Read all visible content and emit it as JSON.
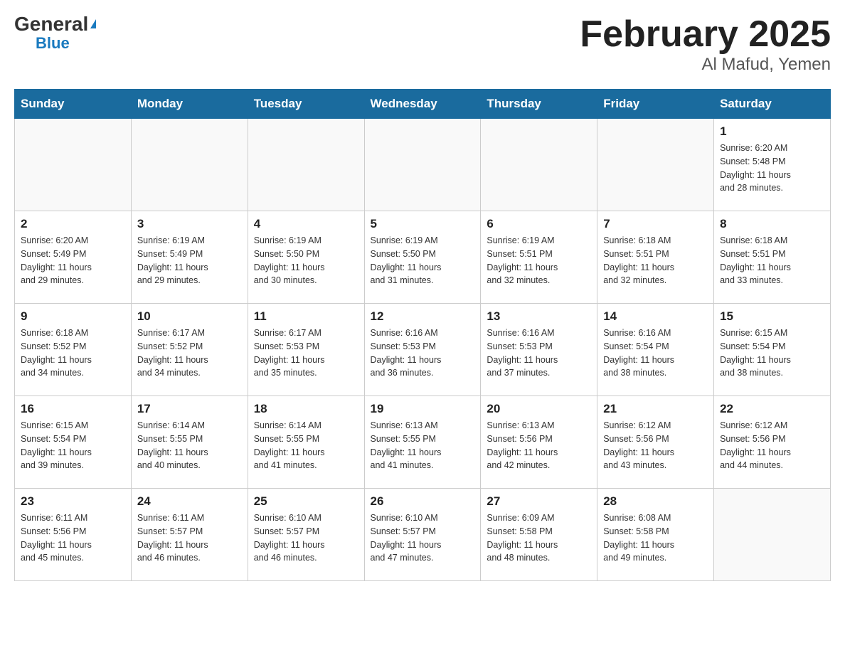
{
  "logo": {
    "general": "General",
    "blue": "Blue"
  },
  "title": {
    "month": "February 2025",
    "location": "Al Mafud, Yemen"
  },
  "weekdays": [
    "Sunday",
    "Monday",
    "Tuesday",
    "Wednesday",
    "Thursday",
    "Friday",
    "Saturday"
  ],
  "weeks": [
    [
      {
        "day": "",
        "info": ""
      },
      {
        "day": "",
        "info": ""
      },
      {
        "day": "",
        "info": ""
      },
      {
        "day": "",
        "info": ""
      },
      {
        "day": "",
        "info": ""
      },
      {
        "day": "",
        "info": ""
      },
      {
        "day": "1",
        "info": "Sunrise: 6:20 AM\nSunset: 5:48 PM\nDaylight: 11 hours\nand 28 minutes."
      }
    ],
    [
      {
        "day": "2",
        "info": "Sunrise: 6:20 AM\nSunset: 5:49 PM\nDaylight: 11 hours\nand 29 minutes."
      },
      {
        "day": "3",
        "info": "Sunrise: 6:19 AM\nSunset: 5:49 PM\nDaylight: 11 hours\nand 29 minutes."
      },
      {
        "day": "4",
        "info": "Sunrise: 6:19 AM\nSunset: 5:50 PM\nDaylight: 11 hours\nand 30 minutes."
      },
      {
        "day": "5",
        "info": "Sunrise: 6:19 AM\nSunset: 5:50 PM\nDaylight: 11 hours\nand 31 minutes."
      },
      {
        "day": "6",
        "info": "Sunrise: 6:19 AM\nSunset: 5:51 PM\nDaylight: 11 hours\nand 32 minutes."
      },
      {
        "day": "7",
        "info": "Sunrise: 6:18 AM\nSunset: 5:51 PM\nDaylight: 11 hours\nand 32 minutes."
      },
      {
        "day": "8",
        "info": "Sunrise: 6:18 AM\nSunset: 5:51 PM\nDaylight: 11 hours\nand 33 minutes."
      }
    ],
    [
      {
        "day": "9",
        "info": "Sunrise: 6:18 AM\nSunset: 5:52 PM\nDaylight: 11 hours\nand 34 minutes."
      },
      {
        "day": "10",
        "info": "Sunrise: 6:17 AM\nSunset: 5:52 PM\nDaylight: 11 hours\nand 34 minutes."
      },
      {
        "day": "11",
        "info": "Sunrise: 6:17 AM\nSunset: 5:53 PM\nDaylight: 11 hours\nand 35 minutes."
      },
      {
        "day": "12",
        "info": "Sunrise: 6:16 AM\nSunset: 5:53 PM\nDaylight: 11 hours\nand 36 minutes."
      },
      {
        "day": "13",
        "info": "Sunrise: 6:16 AM\nSunset: 5:53 PM\nDaylight: 11 hours\nand 37 minutes."
      },
      {
        "day": "14",
        "info": "Sunrise: 6:16 AM\nSunset: 5:54 PM\nDaylight: 11 hours\nand 38 minutes."
      },
      {
        "day": "15",
        "info": "Sunrise: 6:15 AM\nSunset: 5:54 PM\nDaylight: 11 hours\nand 38 minutes."
      }
    ],
    [
      {
        "day": "16",
        "info": "Sunrise: 6:15 AM\nSunset: 5:54 PM\nDaylight: 11 hours\nand 39 minutes."
      },
      {
        "day": "17",
        "info": "Sunrise: 6:14 AM\nSunset: 5:55 PM\nDaylight: 11 hours\nand 40 minutes."
      },
      {
        "day": "18",
        "info": "Sunrise: 6:14 AM\nSunset: 5:55 PM\nDaylight: 11 hours\nand 41 minutes."
      },
      {
        "day": "19",
        "info": "Sunrise: 6:13 AM\nSunset: 5:55 PM\nDaylight: 11 hours\nand 41 minutes."
      },
      {
        "day": "20",
        "info": "Sunrise: 6:13 AM\nSunset: 5:56 PM\nDaylight: 11 hours\nand 42 minutes."
      },
      {
        "day": "21",
        "info": "Sunrise: 6:12 AM\nSunset: 5:56 PM\nDaylight: 11 hours\nand 43 minutes."
      },
      {
        "day": "22",
        "info": "Sunrise: 6:12 AM\nSunset: 5:56 PM\nDaylight: 11 hours\nand 44 minutes."
      }
    ],
    [
      {
        "day": "23",
        "info": "Sunrise: 6:11 AM\nSunset: 5:56 PM\nDaylight: 11 hours\nand 45 minutes."
      },
      {
        "day": "24",
        "info": "Sunrise: 6:11 AM\nSunset: 5:57 PM\nDaylight: 11 hours\nand 46 minutes."
      },
      {
        "day": "25",
        "info": "Sunrise: 6:10 AM\nSunset: 5:57 PM\nDaylight: 11 hours\nand 46 minutes."
      },
      {
        "day": "26",
        "info": "Sunrise: 6:10 AM\nSunset: 5:57 PM\nDaylight: 11 hours\nand 47 minutes."
      },
      {
        "day": "27",
        "info": "Sunrise: 6:09 AM\nSunset: 5:58 PM\nDaylight: 11 hours\nand 48 minutes."
      },
      {
        "day": "28",
        "info": "Sunrise: 6:08 AM\nSunset: 5:58 PM\nDaylight: 11 hours\nand 49 minutes."
      },
      {
        "day": "",
        "info": ""
      }
    ]
  ]
}
